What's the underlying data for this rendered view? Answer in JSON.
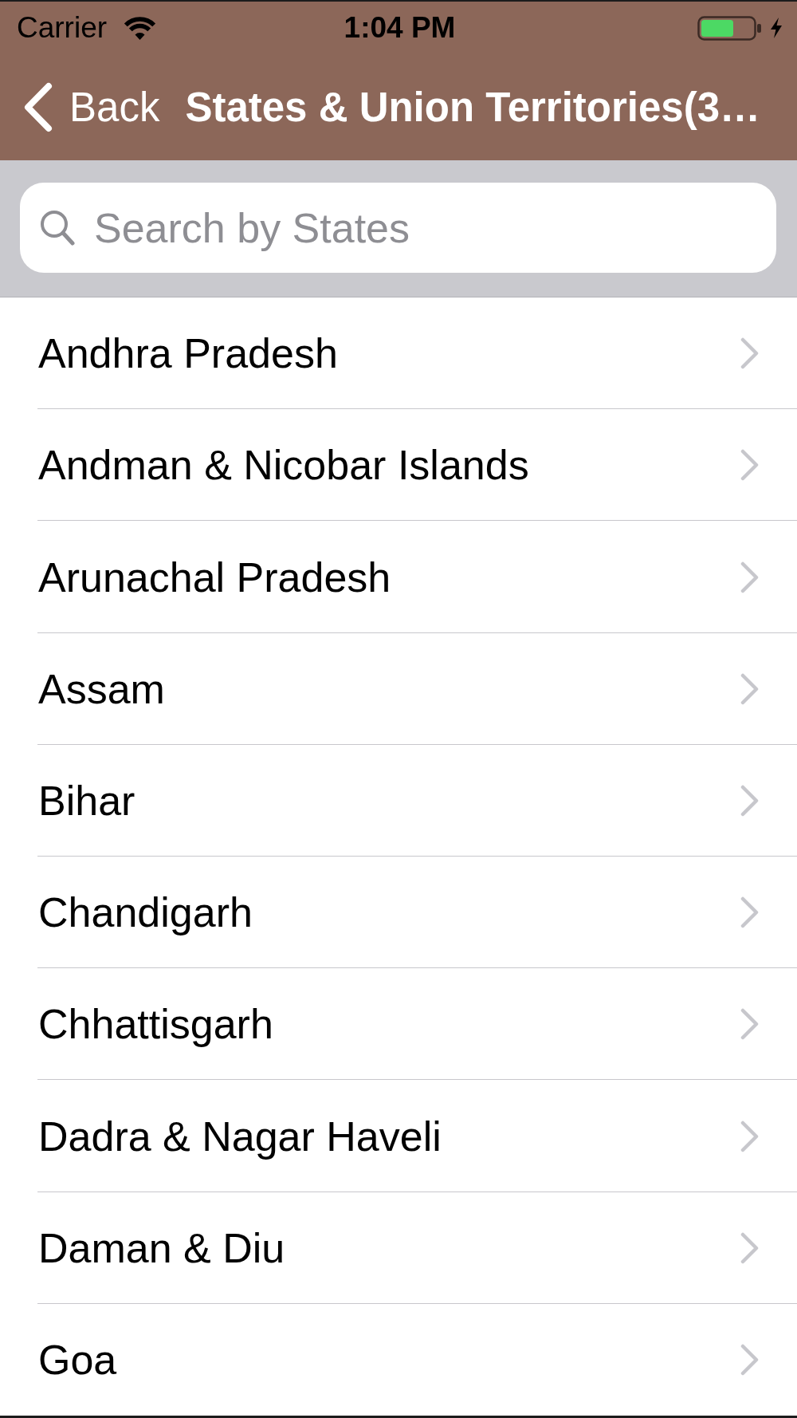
{
  "status_bar": {
    "carrier": "Carrier",
    "time": "1:04 PM"
  },
  "nav_bar": {
    "back": "Back",
    "title": "States & Union Territories(3…"
  },
  "search": {
    "placeholder": "Search by States"
  },
  "states": [
    {
      "name": "Andhra Pradesh"
    },
    {
      "name": "Andman & Nicobar Islands"
    },
    {
      "name": "Arunachal Pradesh"
    },
    {
      "name": "Assam"
    },
    {
      "name": "Bihar"
    },
    {
      "name": "Chandigarh"
    },
    {
      "name": "Chhattisgarh"
    },
    {
      "name": "Dadra & Nagar Haveli"
    },
    {
      "name": "Daman & Diu"
    },
    {
      "name": "Goa"
    }
  ]
}
